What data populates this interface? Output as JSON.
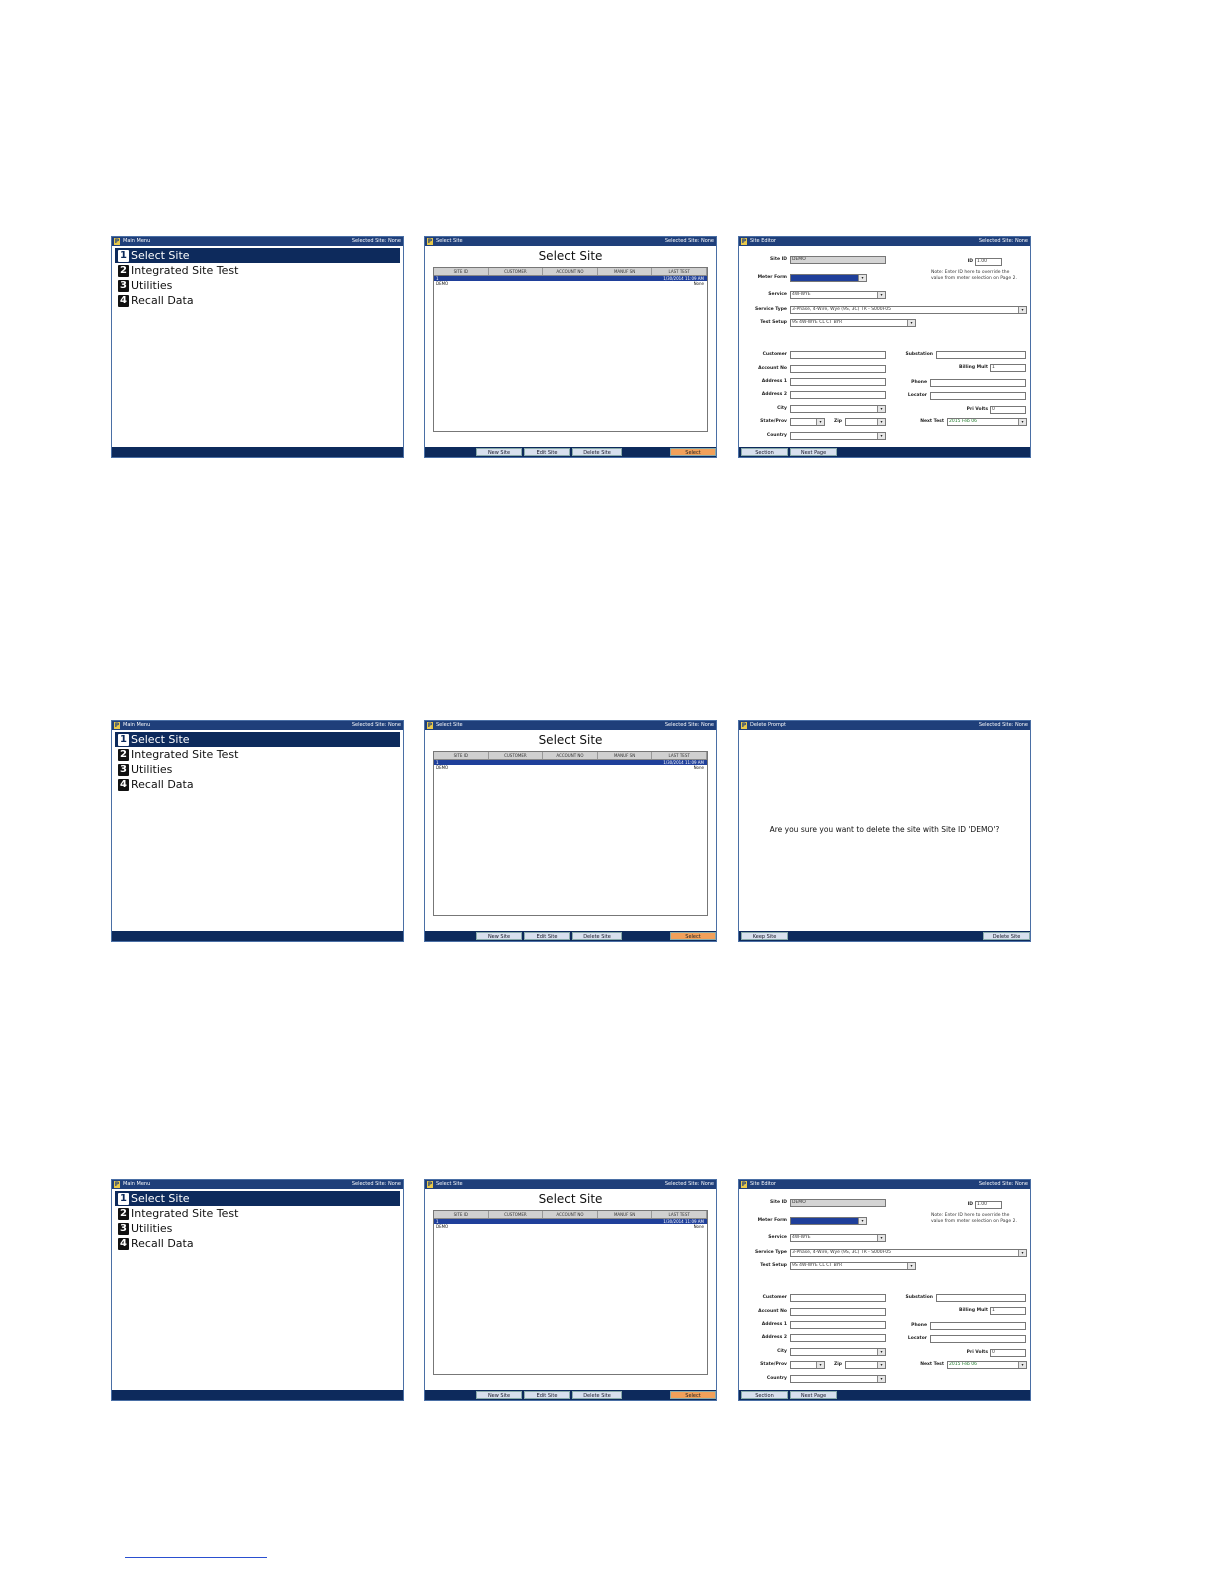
{
  "selected_site": "Selected Site: None",
  "main_menu": {
    "title": "Main Menu",
    "items": [
      {
        "num": "1",
        "label": "Select Site"
      },
      {
        "num": "2",
        "label": "Integrated Site Test"
      },
      {
        "num": "3",
        "label": "Utilities"
      },
      {
        "num": "4",
        "label": "Recall Data"
      }
    ]
  },
  "select_site": {
    "title_bar": "Select Site",
    "heading": "Select Site",
    "columns": [
      "SITE ID",
      "CUSTOMER",
      "ACCOUNT NO",
      "MANUF SN",
      "LAST TEST"
    ],
    "rows": [
      {
        "site_id": "1",
        "last_test": "1/30/2014 11:09 AM"
      },
      {
        "site_id": "DEMO",
        "last_test": "None"
      }
    ],
    "buttons": {
      "new_site": "New Site",
      "edit_site": "Edit Site",
      "delete_site": "Delete Site",
      "select": "Select"
    }
  },
  "site_editor": {
    "title": "Site Editor",
    "labels": {
      "site_id": "Site ID",
      "id": "ID",
      "meter_form": "Meter Form",
      "service": "Service",
      "service_type": "Service Type",
      "test_setup": "Test Setup",
      "customer": "Customer",
      "account_no": "Account No",
      "address1": "Address 1",
      "address2": "Address 2",
      "city": "City",
      "state_prov": "State/Prov",
      "zip": "Zip",
      "country": "Country",
      "substation": "Substation",
      "billing_mult": "Billing Mult",
      "phone": "Phone",
      "locator": "Locator",
      "pri_volts": "Pri Volts",
      "next_test": "Next Test"
    },
    "values": {
      "site_id": "DEMO",
      "id": "1.00",
      "service": "4W-WYE",
      "service_type": "3-Phase, 4-Wire, Wye (9S, 3C) TR - S000F05",
      "test_setup": "9S 4W-WYE CL CT BYR",
      "billing_mult": "1",
      "pri_volts": "0",
      "next_test": "2015 Feb 06"
    },
    "note": "Note: Enter ID here to override the value from meter selection on Page 2.",
    "buttons": {
      "section": "Section",
      "next_page": "Next Page"
    }
  },
  "delete_prompt": {
    "title": "Delete Prompt",
    "message": "Are you sure you want to delete the site with Site ID 'DEMO'?",
    "buttons": {
      "keep_site": "Keep Site",
      "delete_site": "Delete Site"
    }
  }
}
